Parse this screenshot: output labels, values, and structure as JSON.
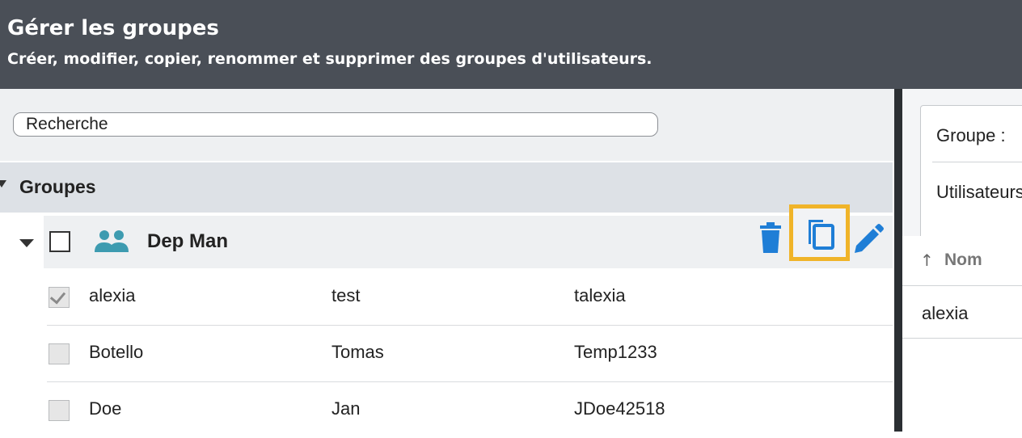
{
  "header": {
    "title": "Gérer les groupes",
    "subtitle": "Créer, modifier, copier, renommer et supprimer des groupes d'utilisateurs."
  },
  "search": {
    "placeholder": "Recherche"
  },
  "tree": {
    "root_label": "Groupes",
    "group": {
      "name": "Dep Man",
      "icon": "users-icon",
      "actions": [
        "delete-icon",
        "copy-icon",
        "edit-icon"
      ],
      "highlighted_action": "copy"
    },
    "users": [
      {
        "last": "alexia",
        "first": "test",
        "login": "talexia",
        "checked": true
      },
      {
        "last": "Botello",
        "first": "Tomas",
        "login": "Temp1233",
        "checked": false
      },
      {
        "last": "Doe",
        "first": "Jan",
        "login": "JDoe42518",
        "checked": false
      }
    ]
  },
  "details": {
    "group_label": "Groupe :",
    "users_label": "Utilisateurs",
    "column_header": "Nom",
    "rows": [
      "alexia"
    ]
  },
  "colors": {
    "header_bg": "#4a4f57",
    "accent_blue": "#1f7ed6",
    "group_icon_teal": "#3d9bb0",
    "highlight": "#f0b429"
  }
}
